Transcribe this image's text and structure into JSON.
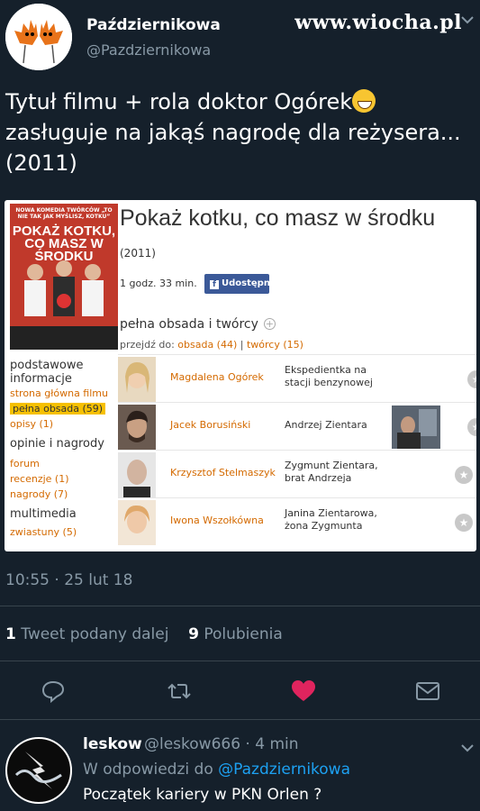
{
  "watermark": "www.wiocha.pl",
  "tweet": {
    "author_name": "Październikowa",
    "author_handle": "@Pazdziernikowa",
    "text_line1": "Tytuł filmu + rola  doktor Ogórek",
    "text_line2": "zasługuje na jakąś nagrodę dla reżysera...",
    "text_line3": "(2011)",
    "timestamp": "10:55 · 25 lut 18",
    "retweets_count": "1",
    "retweets_label": "Tweet podany dalej",
    "likes_count": "9",
    "likes_label": "Polubienia"
  },
  "movie": {
    "poster_top": "NOWA KOMEDIA TWÓRCÓW „TO NIE TAK JAK MYŚLISZ, KOTKU”",
    "poster_title": "POKAŻ KOTKU, CO MASZ W ŚRODKU",
    "title": "Pokaż kotku, co masz w środku",
    "year": "(2011)",
    "duration": "1 godz. 33 min.",
    "share_label": "Udostępnij",
    "cast_header": "pełna obsada i twórcy",
    "jump_prefix": "przejdź do:",
    "jump_cast": "obsada (44)",
    "jump_sep": "|",
    "jump_crew": "twórcy (15)",
    "nav": {
      "basic_header": "podstawowe informacje",
      "main_page": "strona główna filmu",
      "full_cast": "pełna obsada (59)",
      "descriptions": "opisy (1)",
      "opinions_header": "opinie i nagrody",
      "forum": "forum",
      "reviews": "recenzje (1)",
      "awards": "nagrody (7)",
      "multimedia_header": "multimedia",
      "trailers": "zwiastuny (5)"
    },
    "cast": [
      {
        "actor": "Magdalena Ogórek",
        "role": "Ekspedientka na stacji benzynowej"
      },
      {
        "actor": "Jacek Borusiński",
        "role": "Andrzej Zientara"
      },
      {
        "actor": "Krzysztof Stelmaszyk",
        "role": "Zygmunt Zientara, brat Andrzeja"
      },
      {
        "actor": "Iwona Wszołkówna",
        "role": "Janina Zientarowa, żona Zygmunta"
      }
    ]
  },
  "reply": {
    "name": "leskow",
    "meta": "@leskow666 · 4 min",
    "reply_prefix": "W odpowiedzi do",
    "reply_mention": "@Pazdziernikowa",
    "text": "Początek kariery w PKN Orlen ?"
  },
  "colors": {
    "background": "#15202b",
    "muted": "#8899a6",
    "like": "#e0245e",
    "link": "#1da1f2",
    "filmweb_link": "#d46a00"
  },
  "icons": [
    "maple-leaf-avatar-icon",
    "reply-icon",
    "retweet-icon",
    "heart-icon",
    "share-icon",
    "chevron-down-icon",
    "lightning-avatar-icon",
    "facebook-icon",
    "star-icon"
  ]
}
